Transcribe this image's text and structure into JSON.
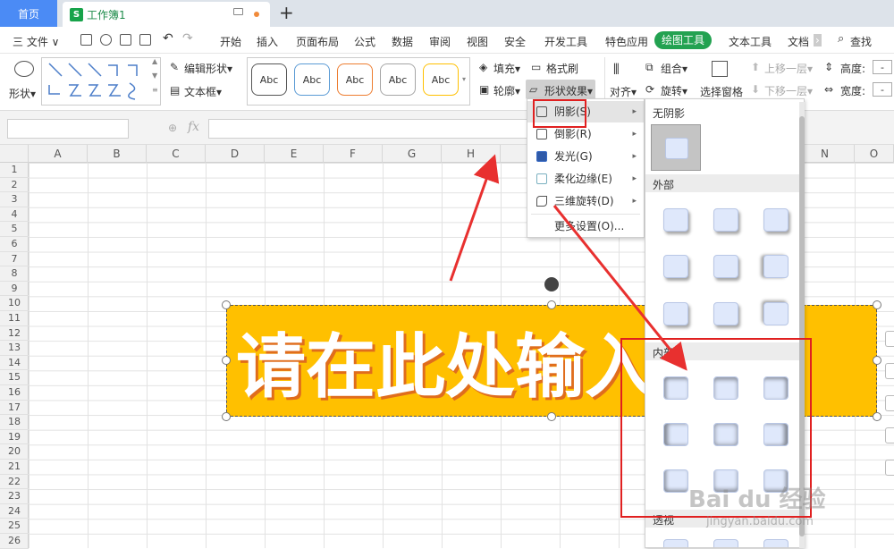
{
  "tabs": {
    "home": "首页",
    "doc": "工作簿1",
    "doc_icon": "S",
    "new_tab": "+"
  },
  "menu": {
    "file": "三 文件 ∨",
    "items": [
      "开始",
      "插入",
      "页面布局",
      "公式",
      "数据",
      "审阅",
      "视图",
      "安全",
      "开发工具",
      "特色应用"
    ],
    "active": "绘图工具",
    "after": [
      "文本工具",
      "文档"
    ],
    "search": "查找"
  },
  "ribbon": {
    "shape_label": "形状▾",
    "edit_shape": "编辑形状▾",
    "text_box": "文本框▾",
    "abc": [
      "Abc",
      "Abc",
      "Abc",
      "Abc",
      "Abc"
    ],
    "abc_colors": [
      "#555555",
      "#5b9bd5",
      "#ed7d31",
      "#a5a5a5",
      "#ffc000"
    ],
    "fill": "填充▾",
    "format_brush": "格式刷",
    "outline": "轮廓▾",
    "shape_effect": "形状效果▾",
    "align": "对齐▾",
    "group": "组合▾",
    "rotate": "旋转▾",
    "selection_pane": "选择窗格",
    "move_up": "上移一层▾",
    "move_down": "下移一层▾",
    "height": "高度:",
    "width": "宽度:",
    "height_val": "-",
    "width_val": "-"
  },
  "formula": {
    "fx": "fx"
  },
  "columns": [
    "A",
    "B",
    "C",
    "D",
    "E",
    "F",
    "G",
    "H",
    "I",
    "J",
    "K",
    "L",
    "M",
    "N",
    "O"
  ],
  "rows": [
    "1",
    "2",
    "3",
    "4",
    "5",
    "6",
    "7",
    "8",
    "9",
    "10",
    "11",
    "12",
    "13",
    "14",
    "15",
    "16",
    "17",
    "18",
    "19",
    "20",
    "21",
    "22",
    "23",
    "24",
    "25",
    "26"
  ],
  "textbox": {
    "text": "请在此处输入文字"
  },
  "context_menu": {
    "items": [
      {
        "label": "阴影(S)",
        "arrow": "▸"
      },
      {
        "label": "倒影(R)",
        "arrow": "▸"
      },
      {
        "label": "发光(G)",
        "arrow": "▸"
      },
      {
        "label": "柔化边缘(E)",
        "arrow": "▸"
      },
      {
        "label": "三维旋转(D)",
        "arrow": "▸"
      },
      {
        "label": "更多设置(O)...",
        "arrow": ""
      }
    ]
  },
  "shadow_panel": {
    "no_shadow": "无阴影",
    "outer": "外部",
    "inner": "内部",
    "perspective": "透视"
  },
  "watermark": {
    "brand": "Bai du 经验",
    "url": "jingyan.baidu.com"
  }
}
